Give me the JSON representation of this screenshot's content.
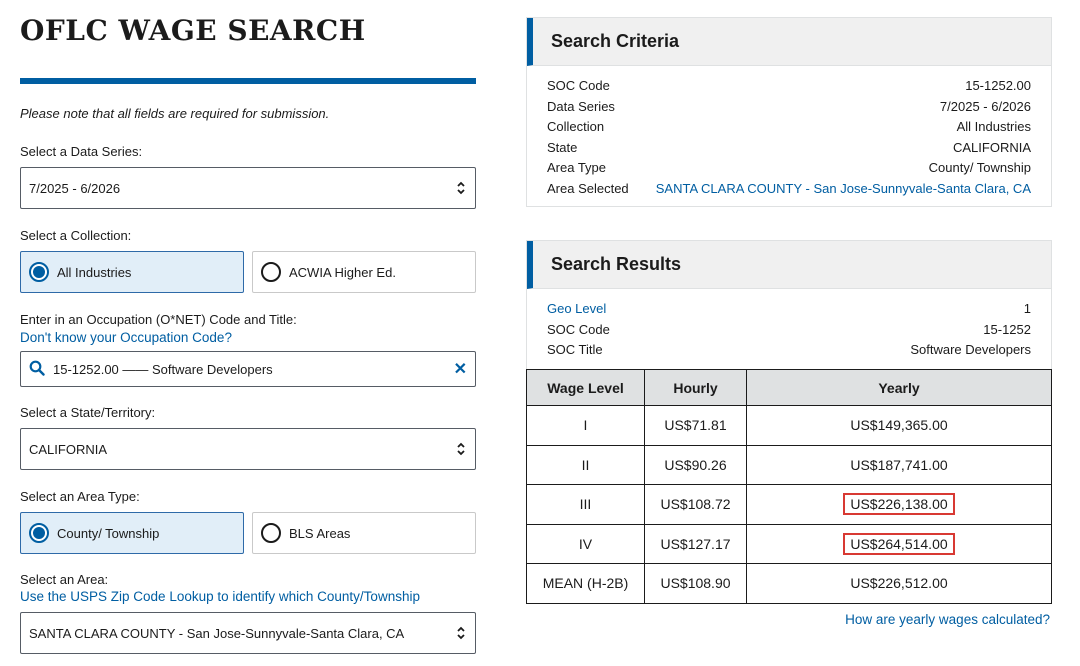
{
  "page_title": "OFLC WAGE SEARCH",
  "note": "Please note that all fields are required for submission.",
  "data_series": {
    "label": "Select a Data Series:",
    "value": "7/2025 - 6/2026"
  },
  "collection": {
    "label": "Select a Collection:",
    "options": [
      {
        "label": "All Industries",
        "selected": true
      },
      {
        "label": "ACWIA Higher Ed.",
        "selected": false
      }
    ]
  },
  "occupation": {
    "label": "Enter in an Occupation (O*NET) Code and Title:",
    "help_link": "Don't know your Occupation Code?",
    "value": "15-1252.00 —— Software Developers",
    "search_icon": "search-icon",
    "clear_icon": "close-icon"
  },
  "state": {
    "label": "Select a State/Territory:",
    "value": "CALIFORNIA"
  },
  "area_type": {
    "label": "Select an Area Type:",
    "options": [
      {
        "label": "County/ Township",
        "selected": true
      },
      {
        "label": "BLS Areas",
        "selected": false
      }
    ]
  },
  "area": {
    "label": "Select an Area:",
    "help_link": "Use the USPS Zip Code Lookup to identify which County/Township",
    "value": "SANTA CLARA COUNTY - San Jose-Sunnyvale-Santa Clara, CA"
  },
  "criteria": {
    "title": "Search Criteria",
    "rows": [
      {
        "key": "SOC Code",
        "value": "15-1252.00"
      },
      {
        "key": "Data Series",
        "value": "7/2025 - 6/2026"
      },
      {
        "key": "Collection",
        "value": "All Industries"
      },
      {
        "key": "State",
        "value": "CALIFORNIA"
      },
      {
        "key": "Area Type",
        "value": "County/ Township"
      },
      {
        "key": "Area Selected",
        "value": "SANTA CLARA COUNTY - San Jose-Sunnyvale-Santa Clara, CA"
      }
    ]
  },
  "results": {
    "title": "Search Results",
    "rows": [
      {
        "key": "Geo Level",
        "value": "1"
      },
      {
        "key": "SOC Code",
        "value": "15-1252"
      },
      {
        "key": "SOC Title",
        "value": "Software Developers"
      }
    ],
    "table": {
      "headers": [
        "Wage Level",
        "Hourly",
        "Yearly"
      ],
      "rows": [
        [
          "I",
          "US$71.81",
          "US$149,365.00"
        ],
        [
          "II",
          "US$90.26",
          "US$187,741.00"
        ],
        [
          "III",
          "US$108.72",
          "US$226,138.00"
        ],
        [
          "IV",
          "US$127.17",
          "US$264,514.00"
        ],
        [
          "MEAN (H-2B)",
          "US$108.90",
          "US$226,512.00"
        ]
      ]
    },
    "calc_link": "How are yearly wages calculated?"
  },
  "colors": {
    "accent": "#005ea2",
    "highlight": "#d83933",
    "selected_bg": "#e1eef8"
  }
}
